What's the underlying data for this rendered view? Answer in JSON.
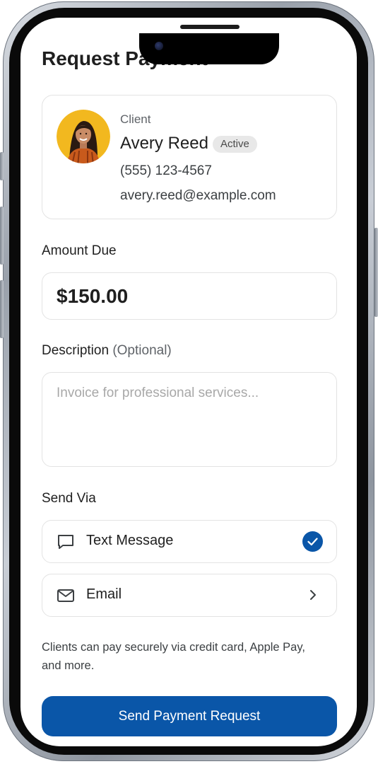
{
  "page": {
    "title": "Request Payment"
  },
  "client": {
    "label": "Client",
    "name": "Avery Reed",
    "status": "Active",
    "phone": "(555) 123-4567",
    "email": "avery.reed@example.com"
  },
  "amount": {
    "label": "Amount Due",
    "value": "$150.00"
  },
  "description": {
    "label": "Description",
    "label_optional": "(Optional)",
    "placeholder": "Invoice for professional services..."
  },
  "send_via": {
    "label": "Send Via",
    "options": [
      {
        "label": "Text Message",
        "icon": "message-icon",
        "selected": true
      },
      {
        "label": "Email",
        "icon": "mail-icon",
        "selected": false
      }
    ]
  },
  "info": {
    "text": "Clients can pay securely via credit card, Apple Pay, and more."
  },
  "actions": {
    "send_label": "Send Payment Request"
  },
  "colors": {
    "accent": "#0a56a8",
    "border": "#e3e3e3",
    "text": "#1f1f1f",
    "muted": "#5f6368",
    "badge_bg": "#e8e8e8",
    "avatar_bg": "#f2b81f"
  }
}
